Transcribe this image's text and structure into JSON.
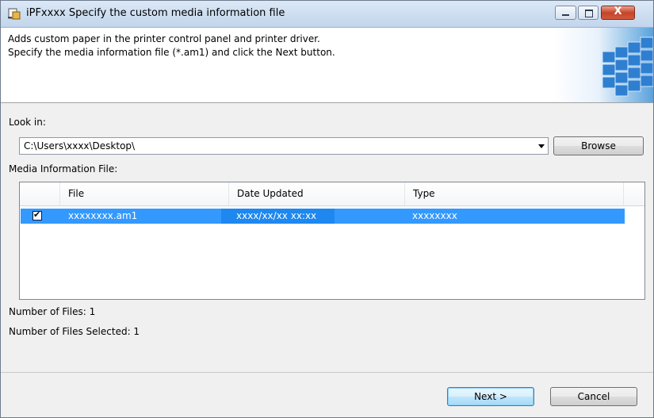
{
  "window": {
    "title": "iPFxxxx Specify the custom media information file",
    "close_symbol": "X"
  },
  "banner": {
    "line1": "Adds custom paper in the printer control panel and printer driver.",
    "line2": "Specify the media information file (*.am1) and click the Next button."
  },
  "look_in": {
    "label": "Look in:",
    "path": "C:\\Users\\xxxx\\Desktop\\",
    "browse_label": "Browse"
  },
  "media_list": {
    "label": "Media Information File:",
    "columns": [
      "File",
      "Date Updated",
      "Type"
    ],
    "rows": [
      {
        "checked": true,
        "file": "xxxxxxxx.am1",
        "date": "xxxx/xx/xx xx:xx",
        "type": "xxxxxxxx"
      }
    ]
  },
  "counts": {
    "files": "Number of Files: 1",
    "selected": "Number of Files Selected: 1"
  },
  "buttons": {
    "next": "Next >",
    "cancel": "Cancel"
  },
  "icons": {
    "app": "printer-app-icon",
    "banner": "paper-stack-illustration"
  },
  "colors": {
    "selection": "#3399ff",
    "title_bar": "#c2d5ec",
    "close_button": "#c5442b"
  }
}
